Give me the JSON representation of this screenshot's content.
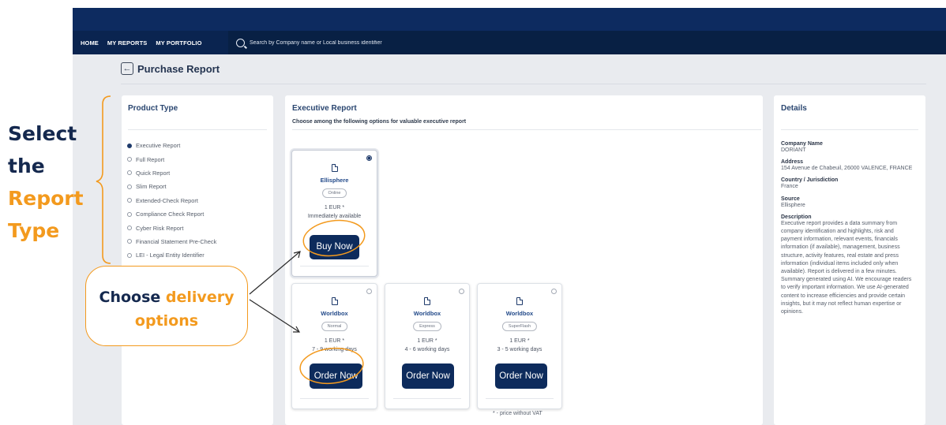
{
  "nav": {
    "home": "HOME",
    "my_reports": "MY REPORTS",
    "my_portfolio": "MY PORTFOLIO",
    "search_placeholder": "Search by Company name or Local business identifier"
  },
  "page": {
    "title": "Purchase Report"
  },
  "product_type": {
    "title": "Product Type",
    "selected_index": 0,
    "items": [
      "Executive Report",
      "Full Report",
      "Quick Report",
      "Slim Report",
      "Extended-Check Report",
      "Compliance Check Report",
      "Cyber Risk Report",
      "Financial Statement Pre-Check",
      "LEI - Legal Entity Identifier"
    ]
  },
  "executive": {
    "title": "Executive Report",
    "subtitle": "Choose among the following options for valuable executive report",
    "vat_note": "* - price without VAT",
    "cards": [
      {
        "provider": "Ellisphere",
        "mode": "Online",
        "price": "1 EUR *",
        "time": "Immediately available",
        "cta": "Buy Now",
        "selected": true
      },
      {
        "provider": "Worldbox",
        "mode": "Normal",
        "price": "1 EUR *",
        "time": "7 - 9 working days",
        "cta": "Order Now",
        "selected": false
      },
      {
        "provider": "Worldbox",
        "mode": "Express",
        "price": "1 EUR *",
        "time": "4 - 6 working days",
        "cta": "Order Now",
        "selected": false
      },
      {
        "provider": "Worldbox",
        "mode": "SuperFlash",
        "price": "1 EUR *",
        "time": "3 - 5 working days",
        "cta": "Order Now",
        "selected": false
      }
    ]
  },
  "details": {
    "title": "Details",
    "company_name_label": "Company Name",
    "company_name": "DORIANT",
    "address_label": "Address",
    "address": "154 Avenue de Chabeuil, 26000 VALENCE, FRANCE",
    "country_label": "Country / Jurisdiction",
    "country": "France",
    "source_label": "Source",
    "source": "Ellisphere",
    "description_label": "Description",
    "description": "Executive report provides a data summary from company identification and highlights, risk and payment information, relevant events, financials information (if available), management, business structure, activity features, real estate and press information (individual items included only when available). Report is delivered in a few minutes. Summary generated using AI. We encourage readers to verify important information. We use AI-generated content to increase efficiencies and provide certain insights, but it may not reflect human expertise or opinions."
  },
  "annotations": {
    "select_line1": "Select",
    "select_line2": "the",
    "select_line3": "Report",
    "select_line4": "Type",
    "bubble_part1": "Choose",
    "bubble_part2": "delivery",
    "bubble_part3": "options"
  },
  "colors": {
    "navy": "#0d2b5c",
    "accent": "#f39a1e",
    "link": "#244b8a"
  }
}
